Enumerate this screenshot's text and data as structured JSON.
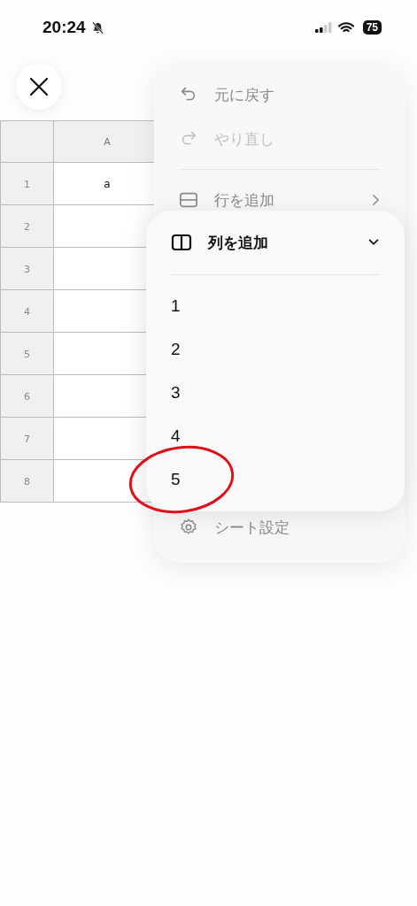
{
  "status_bar": {
    "time": "20:24",
    "battery": "75"
  },
  "table": {
    "columns": [
      "A"
    ],
    "rows": [
      {
        "header": "1",
        "cells": [
          "a"
        ]
      },
      {
        "header": "2",
        "cells": [
          ""
        ]
      },
      {
        "header": "3",
        "cells": [
          ""
        ]
      },
      {
        "header": "4",
        "cells": [
          ""
        ]
      },
      {
        "header": "5",
        "cells": [
          ""
        ]
      },
      {
        "header": "6",
        "cells": [
          ""
        ]
      },
      {
        "header": "7",
        "cells": [
          ""
        ]
      },
      {
        "header": "8",
        "cells": [
          ""
        ]
      }
    ]
  },
  "menu": {
    "items": [
      {
        "kind": "undo",
        "label": "元に戻す",
        "disabled": false
      },
      {
        "kind": "redo",
        "label": "やり直し",
        "disabled": true
      },
      {
        "kind": "divider"
      },
      {
        "kind": "add-row",
        "label": "行を追加",
        "disabled": false
      },
      {
        "kind": "spacer"
      },
      {
        "kind": "settings",
        "label": "シート設定",
        "disabled": false
      }
    ]
  },
  "submenu": {
    "label": "列を追加",
    "expanded": true,
    "items": [
      {
        "label": "1",
        "highlighted": false
      },
      {
        "label": "2",
        "highlighted": false
      },
      {
        "label": "3",
        "highlighted": false
      },
      {
        "label": "4",
        "highlighted": false
      },
      {
        "label": "5",
        "highlighted": true
      }
    ]
  }
}
